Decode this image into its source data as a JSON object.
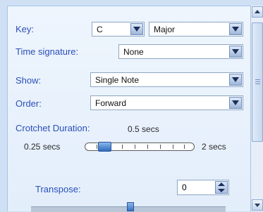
{
  "key": {
    "label": "Key:",
    "note_value": "C",
    "mode_value": "Major"
  },
  "time_signature": {
    "label": "Time signature:",
    "value": "None"
  },
  "show": {
    "label": "Show:",
    "value": "Single Note"
  },
  "order": {
    "label": "Order:",
    "value": "Forward"
  },
  "crotchet_duration": {
    "label": "Crotchet Duration:",
    "value_text": "0.5 secs",
    "min_label": "0.25 secs",
    "max_label": "2 secs",
    "slider_position_fraction": 0.14
  },
  "transpose": {
    "label": "Transpose:",
    "value": "0"
  },
  "colors": {
    "label_blue": "#2b4fb8",
    "panel_bg": "#eaf2fc",
    "accent": "#2f6dbd"
  },
  "icons": [
    "dropdown-arrow-icon",
    "spin-arrows-icon",
    "scroll-up-icon",
    "scroll-down-icon"
  ]
}
